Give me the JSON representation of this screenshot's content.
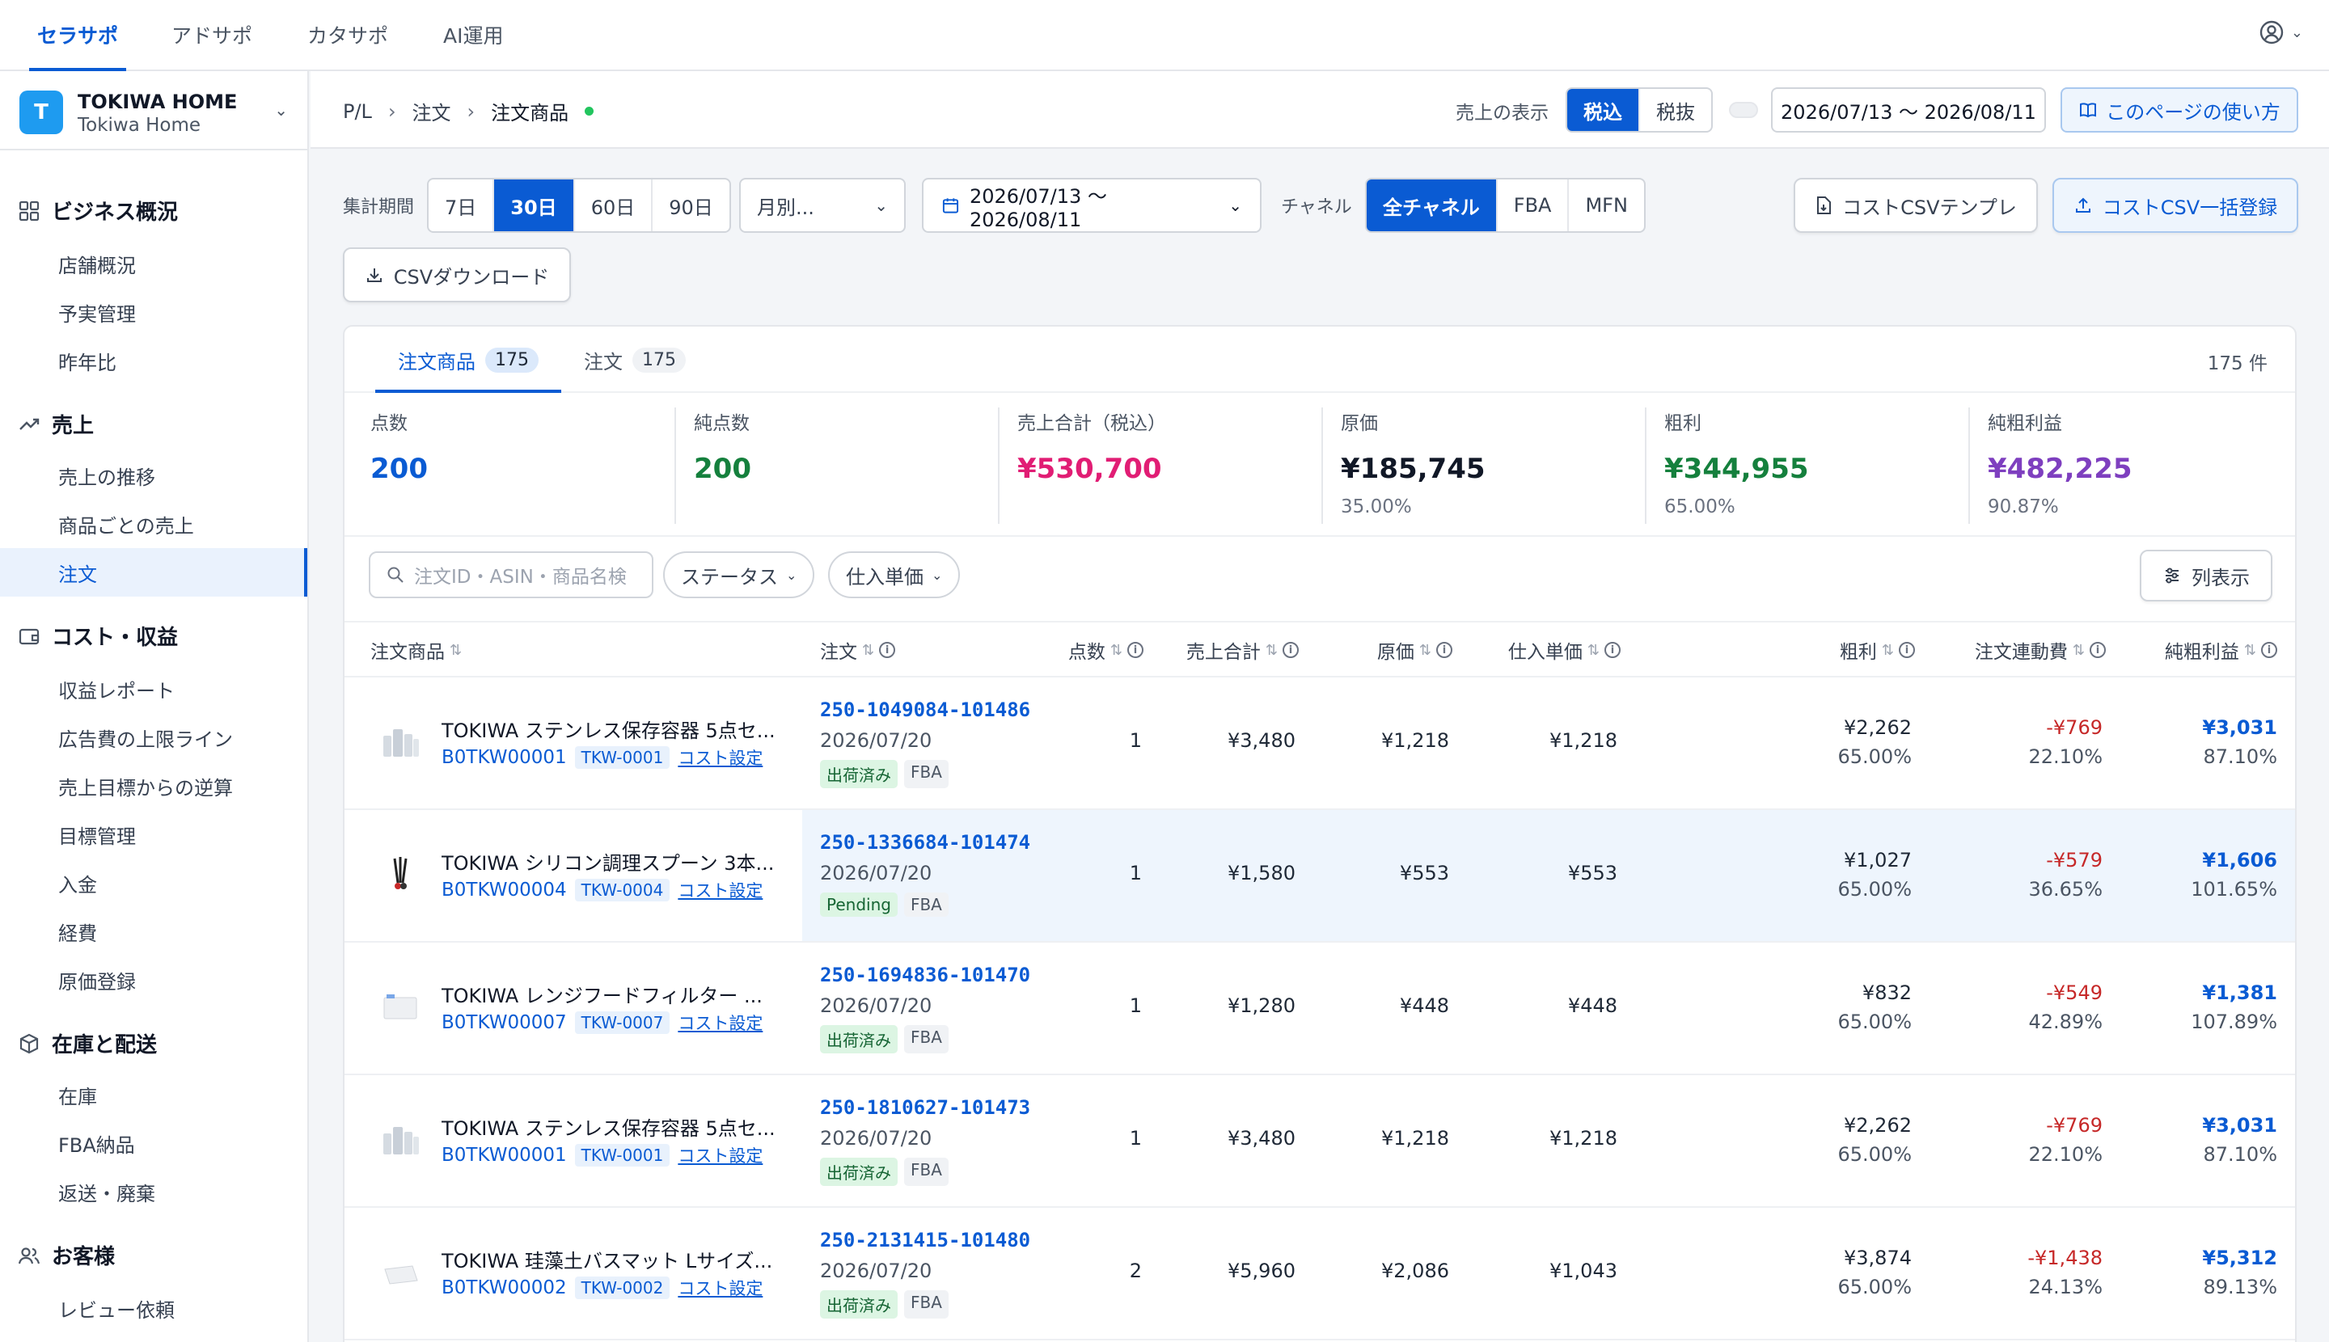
{
  "top_nav": {
    "items": [
      "セラサポ",
      "アドサポ",
      "カタサポ",
      "AI運用"
    ],
    "active": 0
  },
  "store": {
    "initial": "T",
    "name": "TOKIWA HOME",
    "subname": "Tokiwa Home"
  },
  "sidebar": {
    "sections": [
      {
        "title": "ビジネス概況",
        "icon": "grid-icon",
        "items": [
          "店舗概況",
          "予実管理",
          "昨年比"
        ]
      },
      {
        "title": "売上",
        "icon": "trend-icon",
        "items": [
          "売上の推移",
          "商品ごとの売上",
          "注文"
        ]
      },
      {
        "title": "コスト・収益",
        "icon": "wallet-icon",
        "items": [
          "収益レポート",
          "広告費の上限ライン",
          "売上目標からの逆算",
          "目標管理",
          "入金",
          "経費",
          "原価登録"
        ]
      },
      {
        "title": "在庫と配送",
        "icon": "box-icon",
        "items": [
          "在庫",
          "FBA納品",
          "返送・廃棄"
        ]
      },
      {
        "title": "お客様",
        "icon": "users-icon",
        "items": [
          "レビュー依頼"
        ]
      }
    ],
    "active_item": "注文"
  },
  "breadcrumb": [
    "P/L",
    "注文",
    "注文商品"
  ],
  "sales_display": {
    "label": "売上の表示",
    "options": [
      "税込",
      "税抜"
    ],
    "active": 0
  },
  "header_date_range": "2026/07/13 〜 2026/08/11",
  "help_button": "このページの使い方",
  "filters": {
    "period_label": "集計期間",
    "periods": [
      "7日",
      "30日",
      "60日",
      "90日"
    ],
    "active_period": 1,
    "granularity": "月別...",
    "date_range": "2026/07/13 〜 2026/08/11",
    "channel_label": "チャネル",
    "channels": [
      "全チャネル",
      "FBA",
      "MFN"
    ],
    "active_channel": 0,
    "cost_template": "コストCSVテンプレ",
    "cost_bulk": "コストCSV一括登録",
    "csv_download": "CSVダウンロード"
  },
  "tabs": [
    {
      "label": "注文商品",
      "count": "175"
    },
    {
      "label": "注文",
      "count": "175"
    }
  ],
  "total_count": "175 件",
  "stats": [
    {
      "label": "点数",
      "value": "200",
      "sub": "",
      "color": "#0a5bd3"
    },
    {
      "label": "純点数",
      "value": "200",
      "sub": "",
      "color": "#15803d"
    },
    {
      "label": "売上合計（税込）",
      "value": "¥530,700",
      "sub": "",
      "color": "#e11d74"
    },
    {
      "label": "原価",
      "value": "¥185,745",
      "sub": "35.00%",
      "color": "#111827"
    },
    {
      "label": "粗利",
      "value": "¥344,955",
      "sub": "65.00%",
      "color": "#15803d"
    },
    {
      "label": "純粗利益",
      "value": "¥482,225",
      "sub": "90.87%",
      "color": "#7e3fbf"
    }
  ],
  "search_placeholder": "注文ID・ASIN・商品名検",
  "chips": [
    "ステータス",
    "仕入単価"
  ],
  "column_button": "列表示",
  "columns": [
    "注文商品",
    "注文",
    "点数",
    "売上合計",
    "原価",
    "仕入単価",
    "粗利",
    "注文連動費",
    "純粗利益"
  ],
  "rows": [
    {
      "thumb": "container",
      "name": "TOKIWA ステンレス保存容器 5点セ...",
      "asin": "B0TKW00001",
      "sku": "TKW-0001",
      "cost_link": "コスト設定",
      "order_id": "250-1049084-101486",
      "date": "2026/07/20",
      "status": "出荷済み",
      "channel": "FBA",
      "qty": "1",
      "sales": "¥3,480",
      "cost": "¥1,218",
      "unit_cost": "¥1,218",
      "gross": "¥2,262",
      "gross_pct": "65.00%",
      "fee": "-¥769",
      "fee_pct": "22.10%",
      "net": "¥3,031",
      "net_pct": "87.10%",
      "highlight": false
    },
    {
      "thumb": "spoon",
      "name": "TOKIWA シリコン調理スプーン 3本...",
      "asin": "B0TKW00004",
      "sku": "TKW-0004",
      "cost_link": "コスト設定",
      "order_id": "250-1336684-101474",
      "date": "2026/07/20",
      "status": "Pending",
      "channel": "FBA",
      "qty": "1",
      "sales": "¥1,580",
      "cost": "¥553",
      "unit_cost": "¥553",
      "gross": "¥1,027",
      "gross_pct": "65.00%",
      "fee": "-¥579",
      "fee_pct": "36.65%",
      "net": "¥1,606",
      "net_pct": "101.65%",
      "highlight": true
    },
    {
      "thumb": "filter",
      "name": "TOKIWA レンジフードフィルター ...",
      "asin": "B0TKW00007",
      "sku": "TKW-0007",
      "cost_link": "コスト設定",
      "order_id": "250-1694836-101470",
      "date": "2026/07/20",
      "status": "出荷済み",
      "channel": "FBA",
      "qty": "1",
      "sales": "¥1,280",
      "cost": "¥448",
      "unit_cost": "¥448",
      "gross": "¥832",
      "gross_pct": "65.00%",
      "fee": "-¥549",
      "fee_pct": "42.89%",
      "net": "¥1,381",
      "net_pct": "107.89%",
      "highlight": false
    },
    {
      "thumb": "container",
      "name": "TOKIWA ステンレス保存容器 5点セ...",
      "asin": "B0TKW00001",
      "sku": "TKW-0001",
      "cost_link": "コスト設定",
      "order_id": "250-1810627-101473",
      "date": "2026/07/20",
      "status": "出荷済み",
      "channel": "FBA",
      "qty": "1",
      "sales": "¥3,480",
      "cost": "¥1,218",
      "unit_cost": "¥1,218",
      "gross": "¥2,262",
      "gross_pct": "65.00%",
      "fee": "-¥769",
      "fee_pct": "22.10%",
      "net": "¥3,031",
      "net_pct": "87.10%",
      "highlight": false
    },
    {
      "thumb": "mat",
      "name": "TOKIWA 珪藻土バスマット Lサイズ...",
      "asin": "B0TKW00002",
      "sku": "TKW-0002",
      "cost_link": "コスト設定",
      "order_id": "250-2131415-101480",
      "date": "2026/07/20",
      "status": "出荷済み",
      "channel": "FBA",
      "qty": "2",
      "sales": "¥5,960",
      "cost": "¥2,086",
      "unit_cost": "¥1,043",
      "gross": "¥3,874",
      "gross_pct": "65.00%",
      "fee": "-¥1,438",
      "fee_pct": "24.13%",
      "net": "¥5,312",
      "net_pct": "89.13%",
      "highlight": false
    }
  ]
}
